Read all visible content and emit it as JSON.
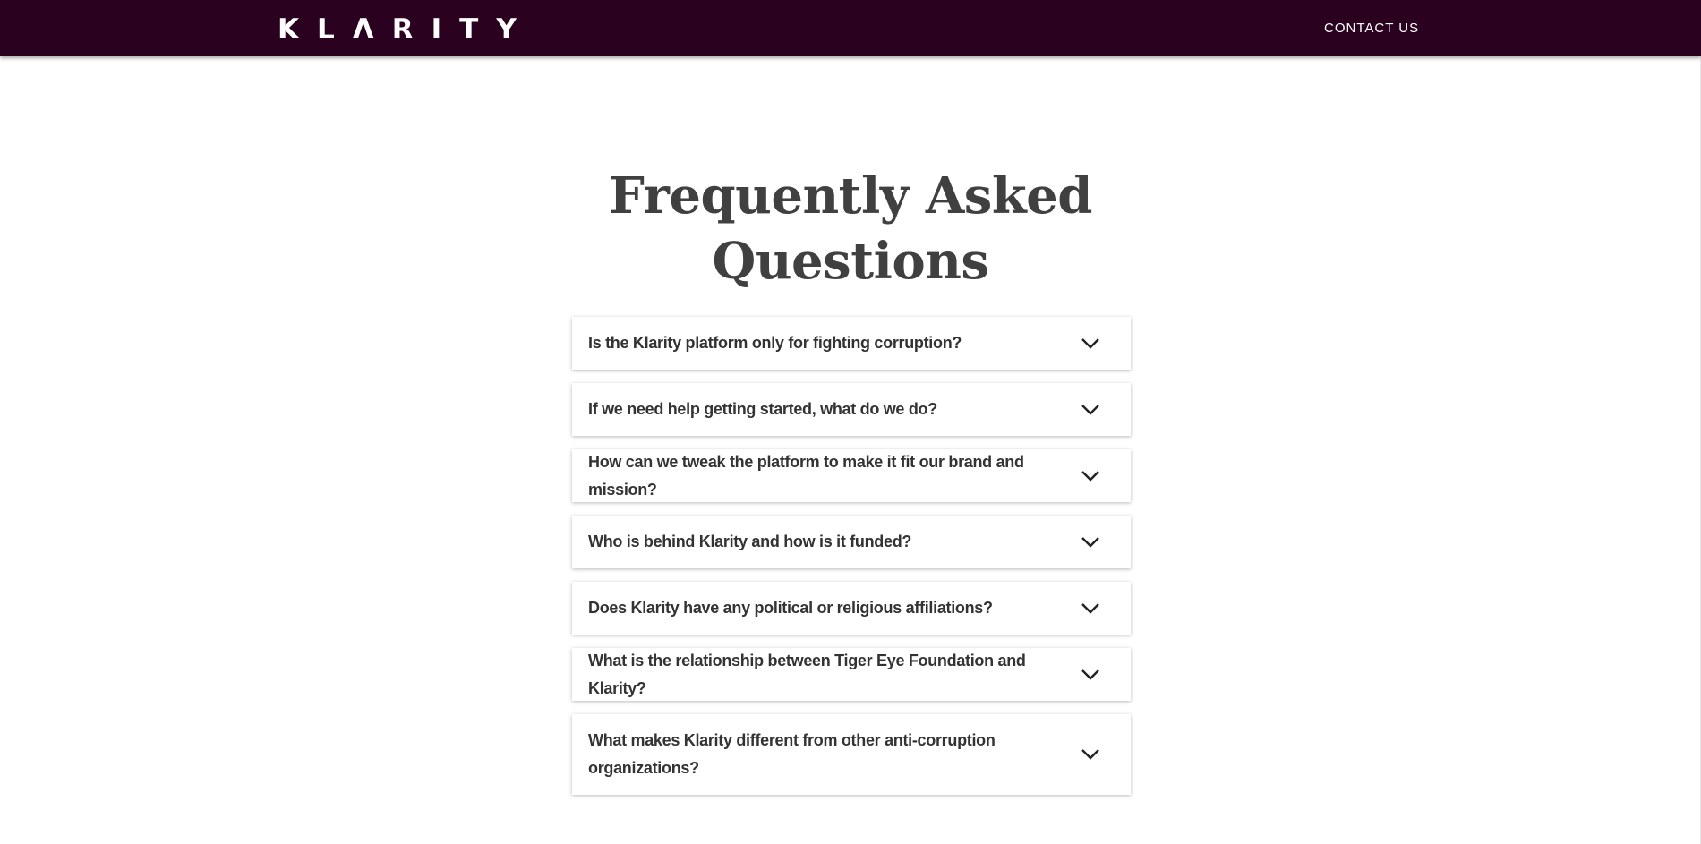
{
  "header": {
    "logo_text": "KLΛRITY",
    "contact_label": "CONTACT US",
    "background": "#2a0220"
  },
  "main": {
    "title": "Frequently Asked Questions"
  },
  "faq": [
    {
      "question": "Is the Klarity platform only for fighting corruption?",
      "icon": "chevron-down-icon"
    },
    {
      "question": "If we need help getting started, what do we do?",
      "icon": "chevron-down-icon"
    },
    {
      "question": "How can we tweak the platform to make it fit our brand and mission?",
      "icon": "chevron-down-icon"
    },
    {
      "question": "Who is behind Klarity and how is it funded?",
      "icon": "chevron-down-icon"
    },
    {
      "question": "Does Klarity have any political or religious affiliations?",
      "icon": "chevron-down-icon"
    },
    {
      "question": "What is the relationship between Tiger Eye Foundation and Klarity?",
      "icon": "chevron-down-icon"
    },
    {
      "question": "What makes Klarity different from other anti-corruption organizations?",
      "icon": "chevron-down-icon"
    }
  ]
}
